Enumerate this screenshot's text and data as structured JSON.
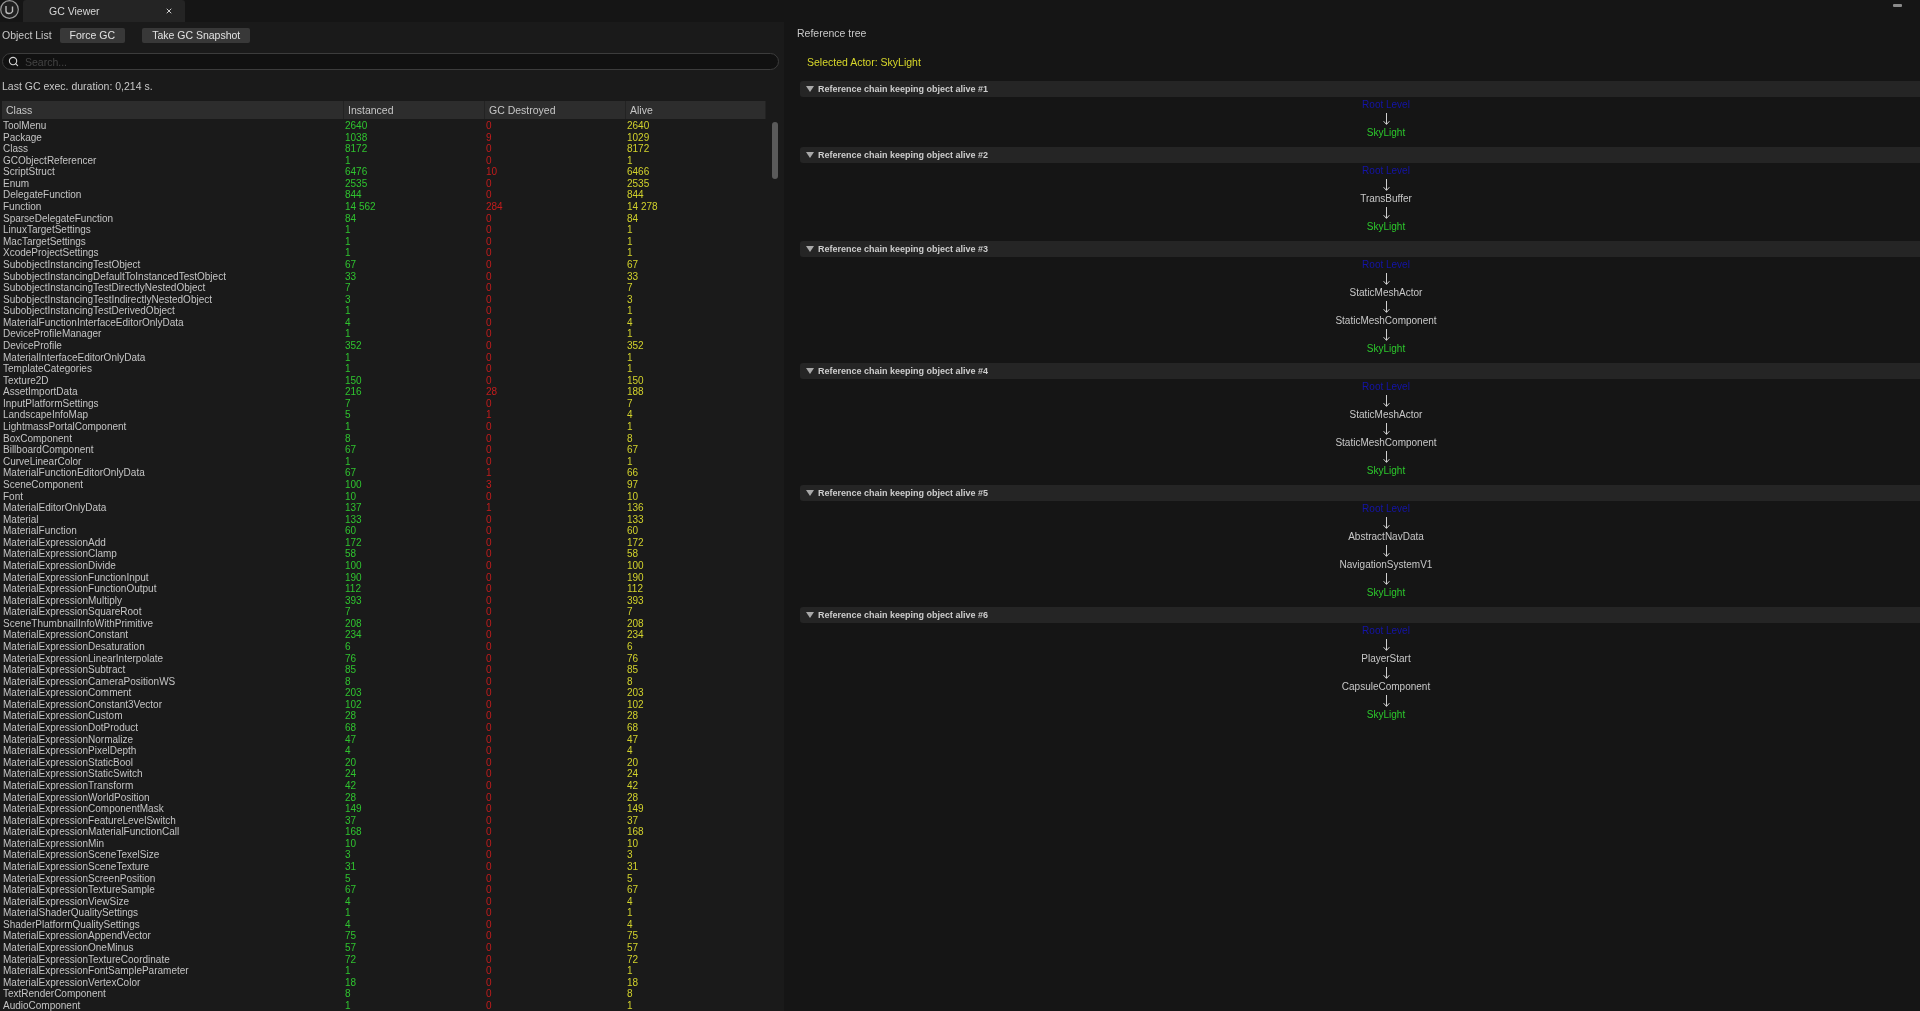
{
  "window": {
    "tab": {
      "title": "GC Viewer"
    }
  },
  "object_list": {
    "label": "Object List",
    "buttons": [
      "Force GC",
      "Take GC Snapshot"
    ],
    "search": {
      "placeholder": "Search..."
    },
    "last_gc": "Last GC exec. duration: 0,214 s."
  },
  "table": {
    "columns": [
      "Class",
      "Instanced",
      "GC Destroyed",
      "Alive"
    ],
    "rows": [
      [
        "ToolMenu",
        "2640",
        "0",
        "2640"
      ],
      [
        "Package",
        "1038",
        "9",
        "1029"
      ],
      [
        "Class",
        "8172",
        "0",
        "8172"
      ],
      [
        "GCObjectReferencer",
        "1",
        "0",
        "1"
      ],
      [
        "ScriptStruct",
        "6476",
        "10",
        "6466"
      ],
      [
        "Enum",
        "2535",
        "0",
        "2535"
      ],
      [
        "DelegateFunction",
        "844",
        "0",
        "844"
      ],
      [
        "Function",
        "14 562",
        "284",
        "14 278"
      ],
      [
        "SparseDelegateFunction",
        "84",
        "0",
        "84"
      ],
      [
        "LinuxTargetSettings",
        "1",
        "0",
        "1"
      ],
      [
        "MacTargetSettings",
        "1",
        "0",
        "1"
      ],
      [
        "XcodeProjectSettings",
        "1",
        "0",
        "1"
      ],
      [
        "SubobjectInstancingTestObject",
        "67",
        "0",
        "67"
      ],
      [
        "SubobjectInstancingDefaultToInstancedTestObject",
        "33",
        "0",
        "33"
      ],
      [
        "SubobjectInstancingTestDirectlyNestedObject",
        "7",
        "0",
        "7"
      ],
      [
        "SubobjectInstancingTestIndirectlyNestedObject",
        "3",
        "0",
        "3"
      ],
      [
        "SubobjectInstancingTestDerivedObject",
        "1",
        "0",
        "1"
      ],
      [
        "MaterialFunctionInterfaceEditorOnlyData",
        "4",
        "0",
        "4"
      ],
      [
        "DeviceProfileManager",
        "1",
        "0",
        "1"
      ],
      [
        "DeviceProfile",
        "352",
        "0",
        "352"
      ],
      [
        "MaterialInterfaceEditorOnlyData",
        "1",
        "0",
        "1"
      ],
      [
        "TemplateCategories",
        "1",
        "0",
        "1"
      ],
      [
        "Texture2D",
        "150",
        "0",
        "150"
      ],
      [
        "AssetImportData",
        "216",
        "28",
        "188"
      ],
      [
        "InputPlatformSettings",
        "7",
        "0",
        "7"
      ],
      [
        "LandscapeInfoMap",
        "5",
        "1",
        "4"
      ],
      [
        "LightmassPortalComponent",
        "1",
        "0",
        "1"
      ],
      [
        "BoxComponent",
        "8",
        "0",
        "8"
      ],
      [
        "BillboardComponent",
        "67",
        "0",
        "67"
      ],
      [
        "CurveLinearColor",
        "1",
        "0",
        "1"
      ],
      [
        "MaterialFunctionEditorOnlyData",
        "67",
        "1",
        "66"
      ],
      [
        "SceneComponent",
        "100",
        "3",
        "97"
      ],
      [
        "Font",
        "10",
        "0",
        "10"
      ],
      [
        "MaterialEditorOnlyData",
        "137",
        "1",
        "136"
      ],
      [
        "Material",
        "133",
        "0",
        "133"
      ],
      [
        "MaterialFunction",
        "60",
        "0",
        "60"
      ],
      [
        "MaterialExpressionAdd",
        "172",
        "0",
        "172"
      ],
      [
        "MaterialExpressionClamp",
        "58",
        "0",
        "58"
      ],
      [
        "MaterialExpressionDivide",
        "100",
        "0",
        "100"
      ],
      [
        "MaterialExpressionFunctionInput",
        "190",
        "0",
        "190"
      ],
      [
        "MaterialExpressionFunctionOutput",
        "112",
        "0",
        "112"
      ],
      [
        "MaterialExpressionMultiply",
        "393",
        "0",
        "393"
      ],
      [
        "MaterialExpressionSquareRoot",
        "7",
        "0",
        "7"
      ],
      [
        "SceneThumbnailInfoWithPrimitive",
        "208",
        "0",
        "208"
      ],
      [
        "MaterialExpressionConstant",
        "234",
        "0",
        "234"
      ],
      [
        "MaterialExpressionDesaturation",
        "6",
        "0",
        "6"
      ],
      [
        "MaterialExpressionLinearInterpolate",
        "76",
        "0",
        "76"
      ],
      [
        "MaterialExpressionSubtract",
        "85",
        "0",
        "85"
      ],
      [
        "MaterialExpressionCameraPositionWS",
        "8",
        "0",
        "8"
      ],
      [
        "MaterialExpressionComment",
        "203",
        "0",
        "203"
      ],
      [
        "MaterialExpressionConstant3Vector",
        "102",
        "0",
        "102"
      ],
      [
        "MaterialExpressionCustom",
        "28",
        "0",
        "28"
      ],
      [
        "MaterialExpressionDotProduct",
        "68",
        "0",
        "68"
      ],
      [
        "MaterialExpressionNormalize",
        "47",
        "0",
        "47"
      ],
      [
        "MaterialExpressionPixelDepth",
        "4",
        "0",
        "4"
      ],
      [
        "MaterialExpressionStaticBool",
        "20",
        "0",
        "20"
      ],
      [
        "MaterialExpressionStaticSwitch",
        "24",
        "0",
        "24"
      ],
      [
        "MaterialExpressionTransform",
        "42",
        "0",
        "42"
      ],
      [
        "MaterialExpressionWorldPosition",
        "28",
        "0",
        "28"
      ],
      [
        "MaterialExpressionComponentMask",
        "149",
        "0",
        "149"
      ],
      [
        "MaterialExpressionFeatureLevelSwitch",
        "37",
        "0",
        "37"
      ],
      [
        "MaterialExpressionMaterialFunctionCall",
        "168",
        "0",
        "168"
      ],
      [
        "MaterialExpressionMin",
        "10",
        "0",
        "10"
      ],
      [
        "MaterialExpressionSceneTexelSize",
        "3",
        "0",
        "3"
      ],
      [
        "MaterialExpressionSceneTexture",
        "31",
        "0",
        "31"
      ],
      [
        "MaterialExpressionScreenPosition",
        "5",
        "0",
        "5"
      ],
      [
        "MaterialExpressionTextureSample",
        "67",
        "0",
        "67"
      ],
      [
        "MaterialExpressionViewSize",
        "4",
        "0",
        "4"
      ],
      [
        "MaterialShaderQualitySettings",
        "1",
        "0",
        "1"
      ],
      [
        "ShaderPlatformQualitySettings",
        "4",
        "0",
        "4"
      ],
      [
        "MaterialExpressionAppendVector",
        "75",
        "0",
        "75"
      ],
      [
        "MaterialExpressionOneMinus",
        "57",
        "0",
        "57"
      ],
      [
        "MaterialExpressionTextureCoordinate",
        "72",
        "0",
        "72"
      ],
      [
        "MaterialExpressionFontSampleParameter",
        "1",
        "0",
        "1"
      ],
      [
        "MaterialExpressionVertexColor",
        "18",
        "0",
        "18"
      ],
      [
        "TextRenderComponent",
        "8",
        "0",
        "8"
      ],
      [
        "AudioComponent",
        "1",
        "0",
        "1"
      ]
    ]
  },
  "reference_tree": {
    "title": "Reference tree",
    "selected_actor": "Selected Actor: SkyLight",
    "chains": [
      {
        "title": "Reference chain keeping object alive #1",
        "expanded": true,
        "nodes": [
          {
            "kind": "root",
            "name": "Root Level"
          },
          {
            "kind": "target",
            "name": "SkyLight"
          }
        ]
      },
      {
        "title": "Reference chain keeping object alive #2",
        "expanded": true,
        "nodes": [
          {
            "kind": "root",
            "name": "Root Level"
          },
          {
            "kind": "object",
            "name": "TransBuffer"
          },
          {
            "kind": "target",
            "name": "SkyLight"
          }
        ]
      },
      {
        "title": "Reference chain keeping object alive #3",
        "expanded": true,
        "nodes": [
          {
            "kind": "root",
            "name": "Root Level"
          },
          {
            "kind": "object",
            "name": "StaticMeshActor"
          },
          {
            "kind": "object",
            "name": "StaticMeshComponent"
          },
          {
            "kind": "target",
            "name": "SkyLight"
          }
        ]
      },
      {
        "title": "Reference chain keeping object alive #4",
        "expanded": true,
        "nodes": [
          {
            "kind": "root",
            "name": "Root Level"
          },
          {
            "kind": "object",
            "name": "StaticMeshActor"
          },
          {
            "kind": "object",
            "name": "StaticMeshComponent"
          },
          {
            "kind": "target",
            "name": "SkyLight"
          }
        ]
      },
      {
        "title": "Reference chain keeping object alive #5",
        "expanded": true,
        "nodes": [
          {
            "kind": "root",
            "name": "Root Level"
          },
          {
            "kind": "object",
            "name": "AbstractNavData"
          },
          {
            "kind": "object",
            "name": "NavigationSystemV1"
          },
          {
            "kind": "target",
            "name": "SkyLight"
          }
        ]
      },
      {
        "title": "Reference chain keeping object alive #6",
        "expanded": true,
        "nodes": [
          {
            "kind": "root",
            "name": "Root Level"
          },
          {
            "kind": "object",
            "name": "PlayerStart"
          },
          {
            "kind": "object",
            "name": "CapsuleComponent"
          },
          {
            "kind": "target",
            "name": "SkyLight"
          }
        ]
      }
    ]
  }
}
